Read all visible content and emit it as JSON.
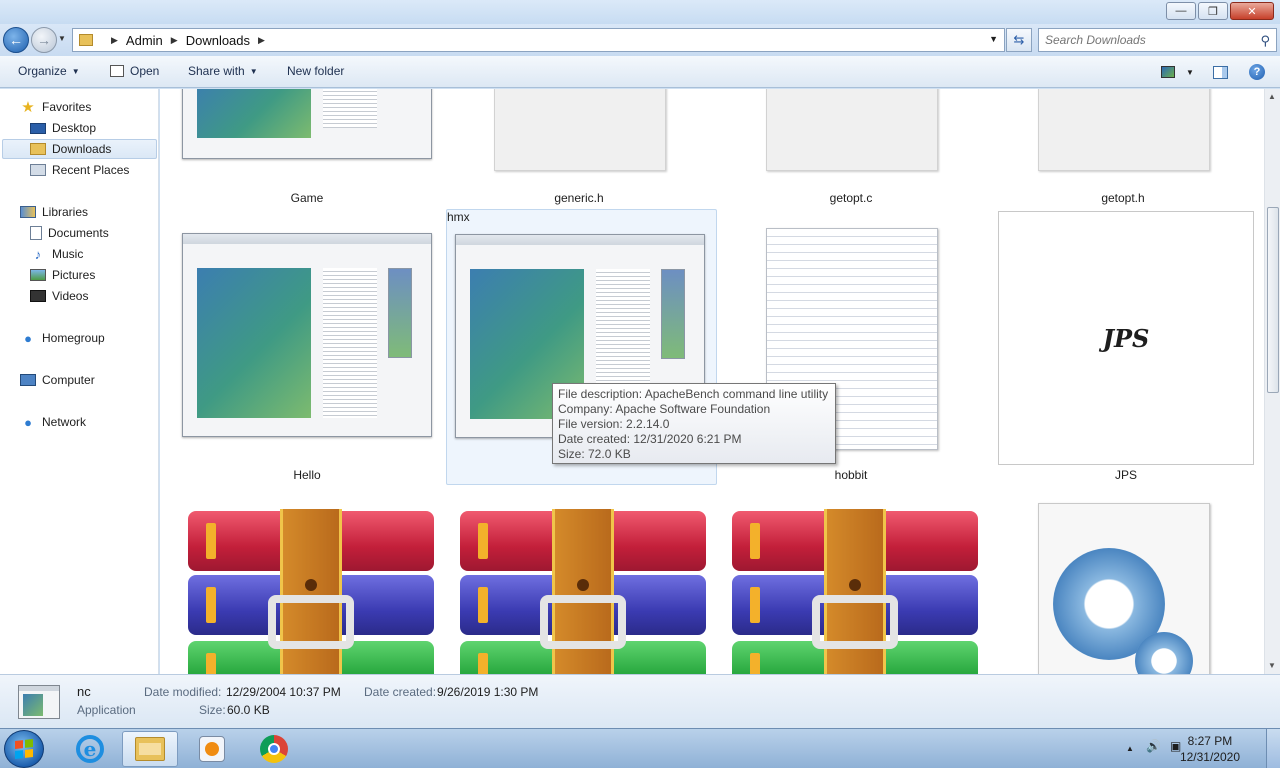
{
  "address": {
    "crumbs": [
      "Admin",
      "Downloads"
    ],
    "search_placeholder": "Search Downloads"
  },
  "toolbar": {
    "organize": "Organize",
    "open": "Open",
    "share_with": "Share with",
    "new_folder": "New folder"
  },
  "nav": {
    "favorites": "Favorites",
    "desktop": "Desktop",
    "downloads": "Downloads",
    "recent": "Recent Places",
    "libraries": "Libraries",
    "documents": "Documents",
    "music": "Music",
    "pictures": "Pictures",
    "videos": "Videos",
    "homegroup": "Homegroup",
    "computer": "Computer",
    "network": "Network"
  },
  "files": {
    "row1": [
      "Game",
      "generic.h",
      "getopt.c",
      "getopt.h"
    ],
    "row2": [
      "Hello",
      "hmx",
      "hobbit",
      "JPS"
    ],
    "jps_thumb_text": "JPS"
  },
  "tooltip": {
    "lines": [
      "File description: ApacheBench command line utility",
      "Company: Apache Software Foundation",
      "File version: 2.2.14.0",
      "Date created: 12/31/2020 6:21 PM",
      "Size: 72.0 KB"
    ]
  },
  "details": {
    "name": "nc",
    "type": "Application",
    "modified_label": "Date modified:",
    "modified_value": "12/29/2004 10:37 PM",
    "created_label": "Date created:",
    "created_value": "9/26/2019 1:30 PM",
    "size_label": "Size:",
    "size_value": "60.0 KB"
  },
  "taskbar": {
    "time": "8:27 PM",
    "date": "12/31/2020"
  }
}
